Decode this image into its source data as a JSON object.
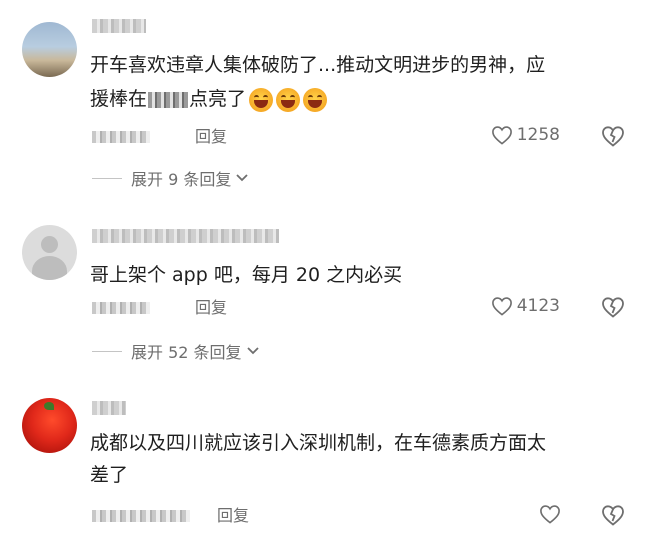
{
  "comments": [
    {
      "text_line1": "开车喜欢违章人集体破防了...推动文明进步的男神，应",
      "text_line2_prefix": "援棒在",
      "text_line2_suffix": "点亮了",
      "emoji_icon": "laughing-face-emoji",
      "reply_label": "回复",
      "likes": "1258",
      "expand_label": "展开 9 条回复"
    },
    {
      "text_line1": "哥上架个 app 吧，每月 20 之内必买",
      "reply_label": "回复",
      "likes": "4123",
      "expand_label": "展开 52 条回复"
    },
    {
      "text_line1": "成都以及四川就应该引入深圳机制，在车德素质方面太",
      "text_line2": "差了",
      "reply_label": "回复",
      "likes": ""
    }
  ],
  "colors": {
    "text": "#1f1f1f",
    "muted": "#6e6e6e",
    "divider": "#c4c4c4"
  }
}
